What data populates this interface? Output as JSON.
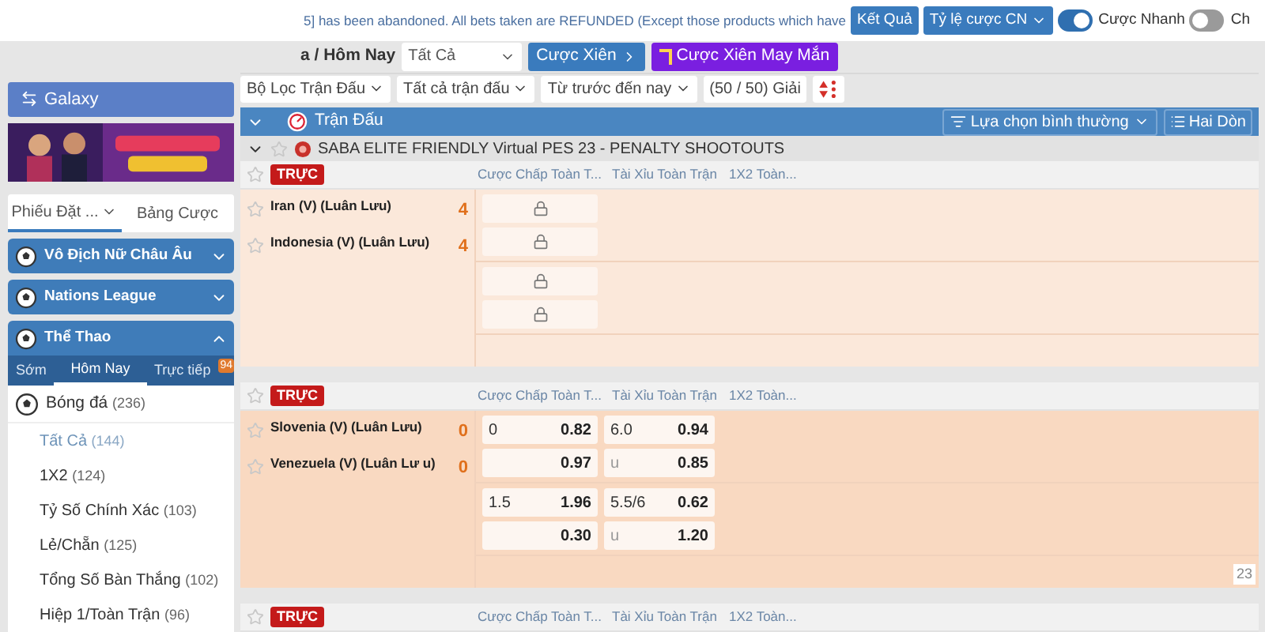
{
  "notice": "5] has been abandoned. All bets taken are REFUNDED (Except those products which have",
  "top_buttons": [
    "Kết Quả",
    "Tỷ lệ cược CN"
  ],
  "toggles": [
    {
      "label": "Cược Nhanh",
      "on": true
    },
    {
      "label": "Ch",
      "on": false
    }
  ],
  "breadcrumb": "a / Hôm Nay",
  "market_select": "Tất Cả",
  "parlay_buttons": [
    {
      "label": "Cược Xiên",
      "kind": "blue"
    },
    {
      "label": "Cược Xiên May Mắn",
      "kind": "purple"
    }
  ],
  "filters": [
    "Bộ Lọc Trận Đấu",
    "Tất cả trận đấu",
    "Từ trước đến nay",
    "(50 / 50) Giải"
  ],
  "section_bar": {
    "title": "Trận Đấu",
    "options": [
      "Lựa chọn bình thường",
      "Hai Dòn"
    ]
  },
  "sidebar": {
    "galaxy": "Galaxy",
    "slip_tabs": [
      {
        "label": "Phiếu Đặt ...",
        "selected": true
      },
      {
        "label": "Bảng Cược",
        "selected": false
      }
    ],
    "sections": [
      {
        "title": "Vô Địch Nữ Châu Âu",
        "expanded": false
      },
      {
        "title": "Nations League",
        "expanded": false
      },
      {
        "title": "Thể Thao",
        "expanded": true
      }
    ],
    "sport_tabs": [
      {
        "label": "Sớm",
        "selected": false
      },
      {
        "label": "Hôm Nay",
        "selected": true
      },
      {
        "label": "Trực tiếp",
        "selected": false,
        "badge": "94"
      }
    ],
    "sport": {
      "name": "Bóng đá",
      "count": "(236)"
    },
    "bet_types": [
      {
        "name": "Tất Cả",
        "count": "(144)",
        "selected": true
      },
      {
        "name": "1X2",
        "count": "(124)",
        "selected": false
      },
      {
        "name": "Tỷ Số Chính Xác",
        "count": "(103)",
        "selected": false
      },
      {
        "name": "Lẻ/Chẵn",
        "count": "(125)",
        "selected": false
      },
      {
        "name": "Tổng Số Bàn Thắng",
        "count": "(102)",
        "selected": false
      },
      {
        "name": "Hiệp 1/Toàn Trận",
        "count": "(96)",
        "selected": false
      }
    ]
  },
  "league": "SABA ELITE FRIENDLY Virtual PES 23 - PENALTY SHOOTOUTS",
  "matches": [
    {
      "live": "TRỰC",
      "columns": [
        "Cược Chấp Toàn T...",
        "Tài Xỉu Toàn Trận",
        "1X2 Toàn..."
      ],
      "teams": [
        {
          "name": "Iran (V) (Luân Lưu)",
          "score": "4"
        },
        {
          "name": "Indonesia (V) (Luân Lưu)",
          "score": "4"
        }
      ],
      "lines": [
        {
          "rows": [
            [
              {
                "kind": "locked"
              },
              {
                "kind": "empty"
              }
            ],
            [
              {
                "kind": "locked"
              },
              {
                "kind": "empty"
              }
            ]
          ]
        },
        {
          "rows": [
            [
              {
                "kind": "locked"
              },
              {
                "kind": "empty"
              }
            ],
            [
              {
                "kind": "locked"
              },
              {
                "kind": "empty"
              }
            ]
          ]
        }
      ]
    },
    {
      "live": "TRỰC",
      "columns": [
        "Cược Chấp Toàn T...",
        "Tài Xỉu Toàn Trận",
        "1X2 Toàn..."
      ],
      "teams": [
        {
          "name": "Slovenia (V) (Luân Lưu)",
          "score": "0"
        },
        {
          "name": "Venezuela (V) (Luân Lư u)",
          "score": "0"
        }
      ],
      "count": "23",
      "lines": [
        {
          "rows": [
            [
              {
                "kind": "odds",
                "line": "0",
                "price": "0.82"
              },
              {
                "kind": "odds",
                "line": "6.0",
                "price": "0.94"
              }
            ],
            [
              {
                "kind": "odds",
                "price": "0.97"
              },
              {
                "kind": "odds",
                "line": "u",
                "price": "0.85"
              }
            ]
          ]
        },
        {
          "rows": [
            [
              {
                "kind": "odds",
                "line": "1.5",
                "price": "1.96"
              },
              {
                "kind": "odds",
                "line": "5.5/6",
                "price": "0.62"
              }
            ],
            [
              {
                "kind": "odds",
                "price": "0.30"
              },
              {
                "kind": "odds",
                "line": "u",
                "price": "1.20"
              }
            ]
          ]
        }
      ]
    },
    {
      "live": "TRỰC",
      "columns": [
        "Cược Chấp Toàn T...",
        "Tài Xỉu Toàn Trận",
        "1X2 Toàn..."
      ]
    }
  ]
}
